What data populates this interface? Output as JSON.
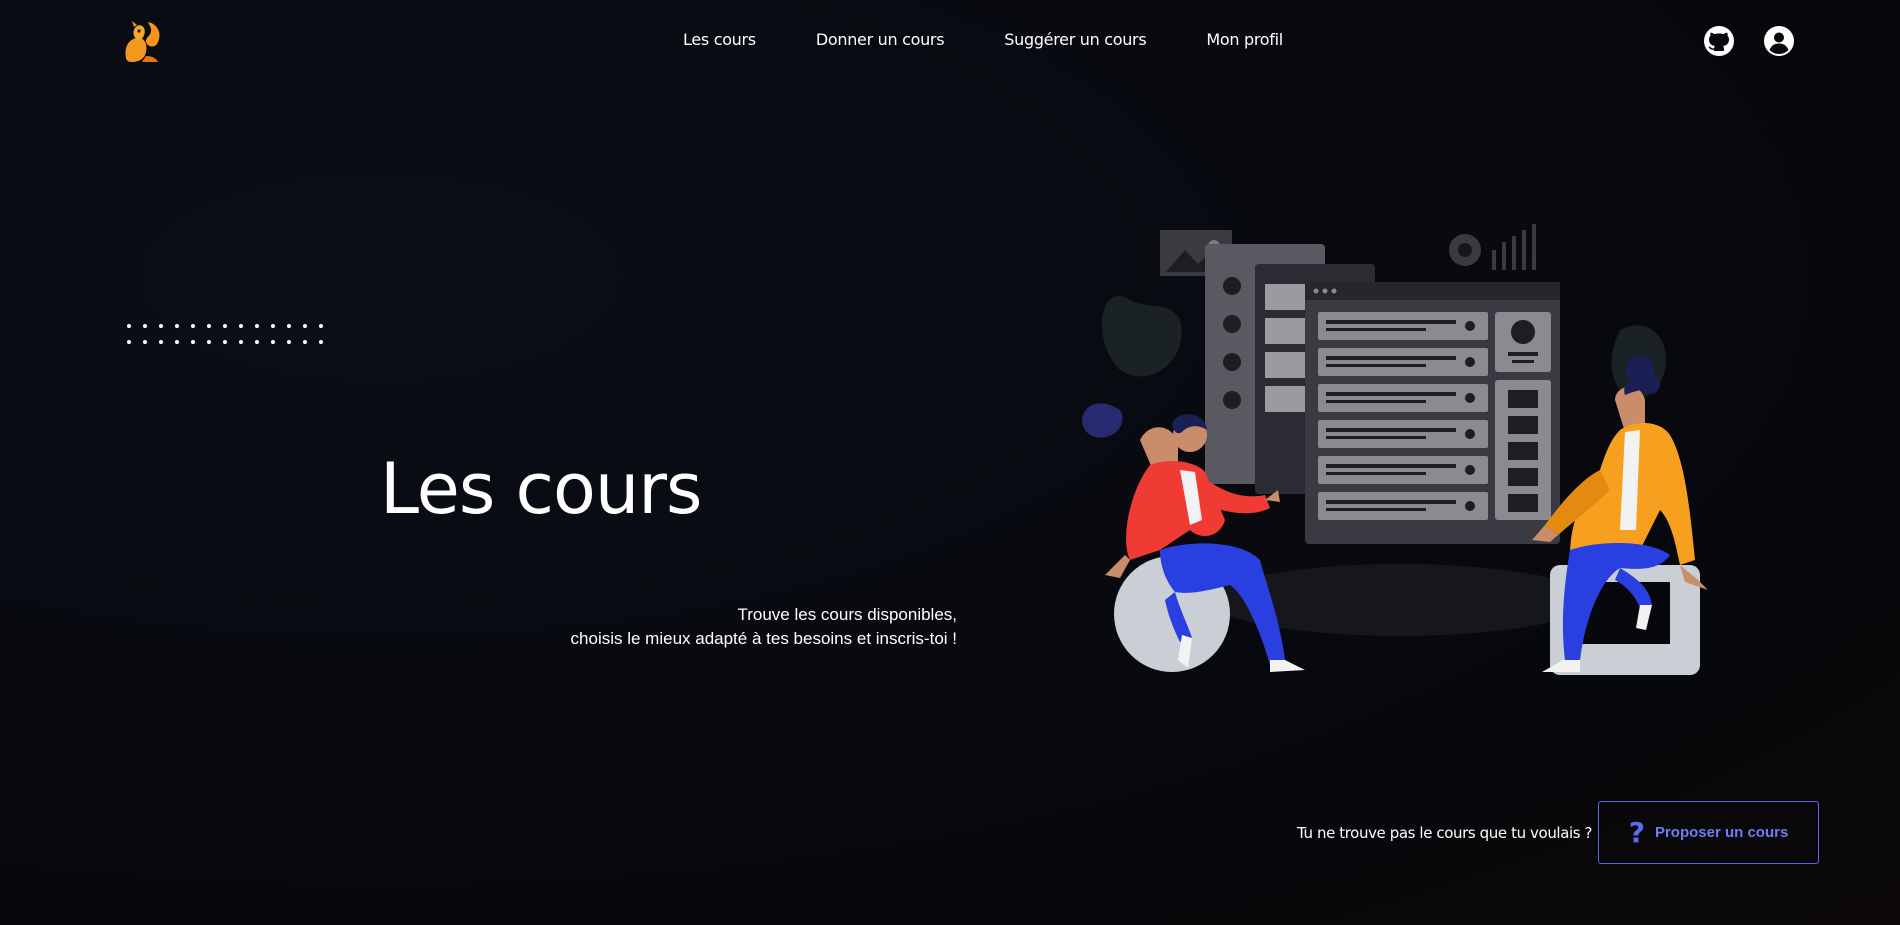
{
  "header": {
    "logo": "squirrel-logo",
    "nav": [
      "Les cours",
      "Donner un cours",
      "Suggérer un cours",
      "Mon profil"
    ],
    "icons": [
      "github-icon",
      "account-icon"
    ]
  },
  "hero": {
    "title": "Les cours",
    "subtitle_line1": "Trouve les cours disponibles,",
    "subtitle_line2": "choisis le mieux adapté à tes besoins et inscris-toi !"
  },
  "cta": {
    "question": "Tu ne trouve pas le cours que tu voulais ?",
    "button_icon": "?",
    "button_label": "Proposer un cours",
    "accent": "#5b6cf0"
  },
  "colors": {
    "background": "#080a10",
    "text": "#ffffff",
    "logo": "#f7941d"
  }
}
